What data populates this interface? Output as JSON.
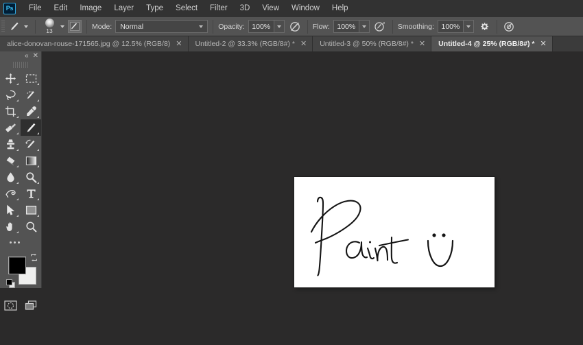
{
  "app": {
    "logo_text": "Ps",
    "logo_color": "#3bbdf0"
  },
  "menubar": {
    "items": [
      {
        "label": "File"
      },
      {
        "label": "Edit"
      },
      {
        "label": "Image"
      },
      {
        "label": "Layer"
      },
      {
        "label": "Type"
      },
      {
        "label": "Select"
      },
      {
        "label": "Filter"
      },
      {
        "label": "3D"
      },
      {
        "label": "View"
      },
      {
        "label": "Window"
      },
      {
        "label": "Help"
      }
    ]
  },
  "options_bar": {
    "tool_icon": "brush-icon",
    "brush_size": "13",
    "mode_label": "Mode:",
    "mode_value": "Normal",
    "opacity_label": "Opacity:",
    "opacity_value": "100%",
    "opacity_pressure_icon": "pressure-opacity-icon",
    "flow_label": "Flow:",
    "flow_value": "100%",
    "airbrush_icon": "airbrush-icon",
    "smoothing_label": "Smoothing:",
    "smoothing_value": "100%",
    "smoothing_settings_icon": "gear-icon",
    "pressure_size_icon": "pressure-size-icon",
    "toggle_brush_panel_icon": "toggle-brush-panel-icon"
  },
  "tabs": [
    {
      "label": "alice-donovan-rouse-171565.jpg @ 12.5% (RGB/8)",
      "close": "✕",
      "active": false
    },
    {
      "label": "Untitled-2 @ 33.3% (RGB/8#) *",
      "close": "✕",
      "active": false
    },
    {
      "label": "Untitled-3 @ 50% (RGB/8#) *",
      "close": "✕",
      "active": false
    },
    {
      "label": "Untitled-4 @ 25% (RGB/8#) *",
      "close": "✕",
      "active": true
    }
  ],
  "toolbar": {
    "collapse_icon": "«",
    "close_icon": "✕",
    "tools": [
      {
        "name": "move-tool",
        "has_corner": true
      },
      {
        "name": "rectangular-marquee-tool",
        "has_corner": true
      },
      {
        "name": "lasso-tool",
        "has_corner": true
      },
      {
        "name": "quick-selection-tool",
        "has_corner": true
      },
      {
        "name": "crop-tool",
        "has_corner": true
      },
      {
        "name": "eyedropper-tool",
        "has_corner": true
      },
      {
        "name": "spot-healing-brush-tool",
        "has_corner": true
      },
      {
        "name": "brush-tool",
        "has_corner": true,
        "active": true
      },
      {
        "name": "clone-stamp-tool",
        "has_corner": true
      },
      {
        "name": "history-brush-tool",
        "has_corner": true
      },
      {
        "name": "eraser-tool",
        "has_corner": true
      },
      {
        "name": "gradient-tool",
        "has_corner": true
      },
      {
        "name": "blur-tool",
        "has_corner": true
      },
      {
        "name": "dodge-tool",
        "has_corner": true
      },
      {
        "name": "pen-tool",
        "has_corner": true
      },
      {
        "name": "type-tool",
        "has_corner": true
      },
      {
        "name": "path-selection-tool",
        "has_corner": true
      },
      {
        "name": "rectangle-tool",
        "has_corner": true
      },
      {
        "name": "hand-tool",
        "has_corner": true
      },
      {
        "name": "zoom-tool",
        "has_corner": false
      }
    ],
    "edit_toolbar_icon": "ellipsis-icon",
    "foreground_color": "#000000",
    "background_color": "#efefee",
    "swap_colors_icon": "swap-colors-icon",
    "default_colors_icon": "default-colors-icon",
    "quick_mask_icon": "quick-mask-icon",
    "screen_mode_icon": "screen-mode-icon"
  },
  "document": {
    "canvas_background": "#ffffff",
    "artwork_description": "Handwritten cursive word 'Paint' with a smiley face drawn beside it",
    "artwork_text": "Paint",
    "ink_color": "#111111"
  },
  "colors": {
    "menubar_bg": "#323232",
    "options_bg": "#535353",
    "tabbar_bg": "#3b3b3b",
    "tab_active_bg": "#535353",
    "workspace_bg": "#2b2a2a",
    "toolbar_bg": "#535353"
  }
}
